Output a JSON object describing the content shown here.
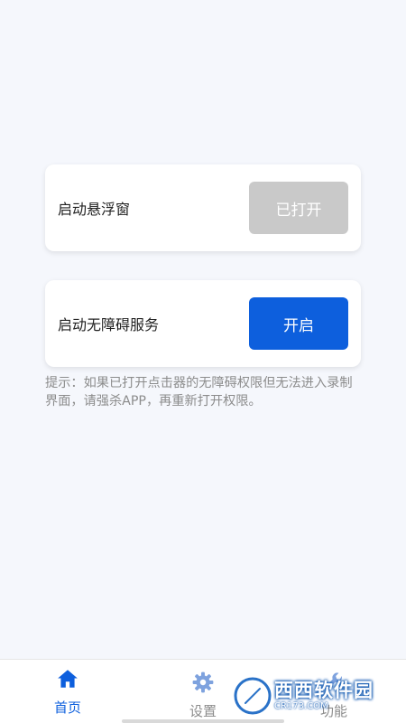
{
  "colors": {
    "background": "#f5f7fc",
    "primary": "#0d5fdd",
    "disabled": "#c9c9c9",
    "hint_text": "#8c8c8c"
  },
  "cards": [
    {
      "label": "启动悬浮窗",
      "button_label": "已打开",
      "button_state": "disabled"
    },
    {
      "label": "启动无障碍服务",
      "button_label": "开启",
      "button_state": "active"
    }
  ],
  "hint": "提示：如果已打开点击器的无障碍权限但无法进入录制界面，请强杀APP，再重新打开权限。",
  "tabbar": {
    "items": [
      {
        "label": "首页",
        "icon": "home-icon",
        "active": true
      },
      {
        "label": "设置",
        "icon": "gear-icon",
        "active": false
      },
      {
        "label": "功能",
        "icon": "wrench-icon",
        "active": false
      }
    ]
  },
  "watermark": {
    "title": "西西软件园",
    "subtitle": "CR173.COM"
  }
}
